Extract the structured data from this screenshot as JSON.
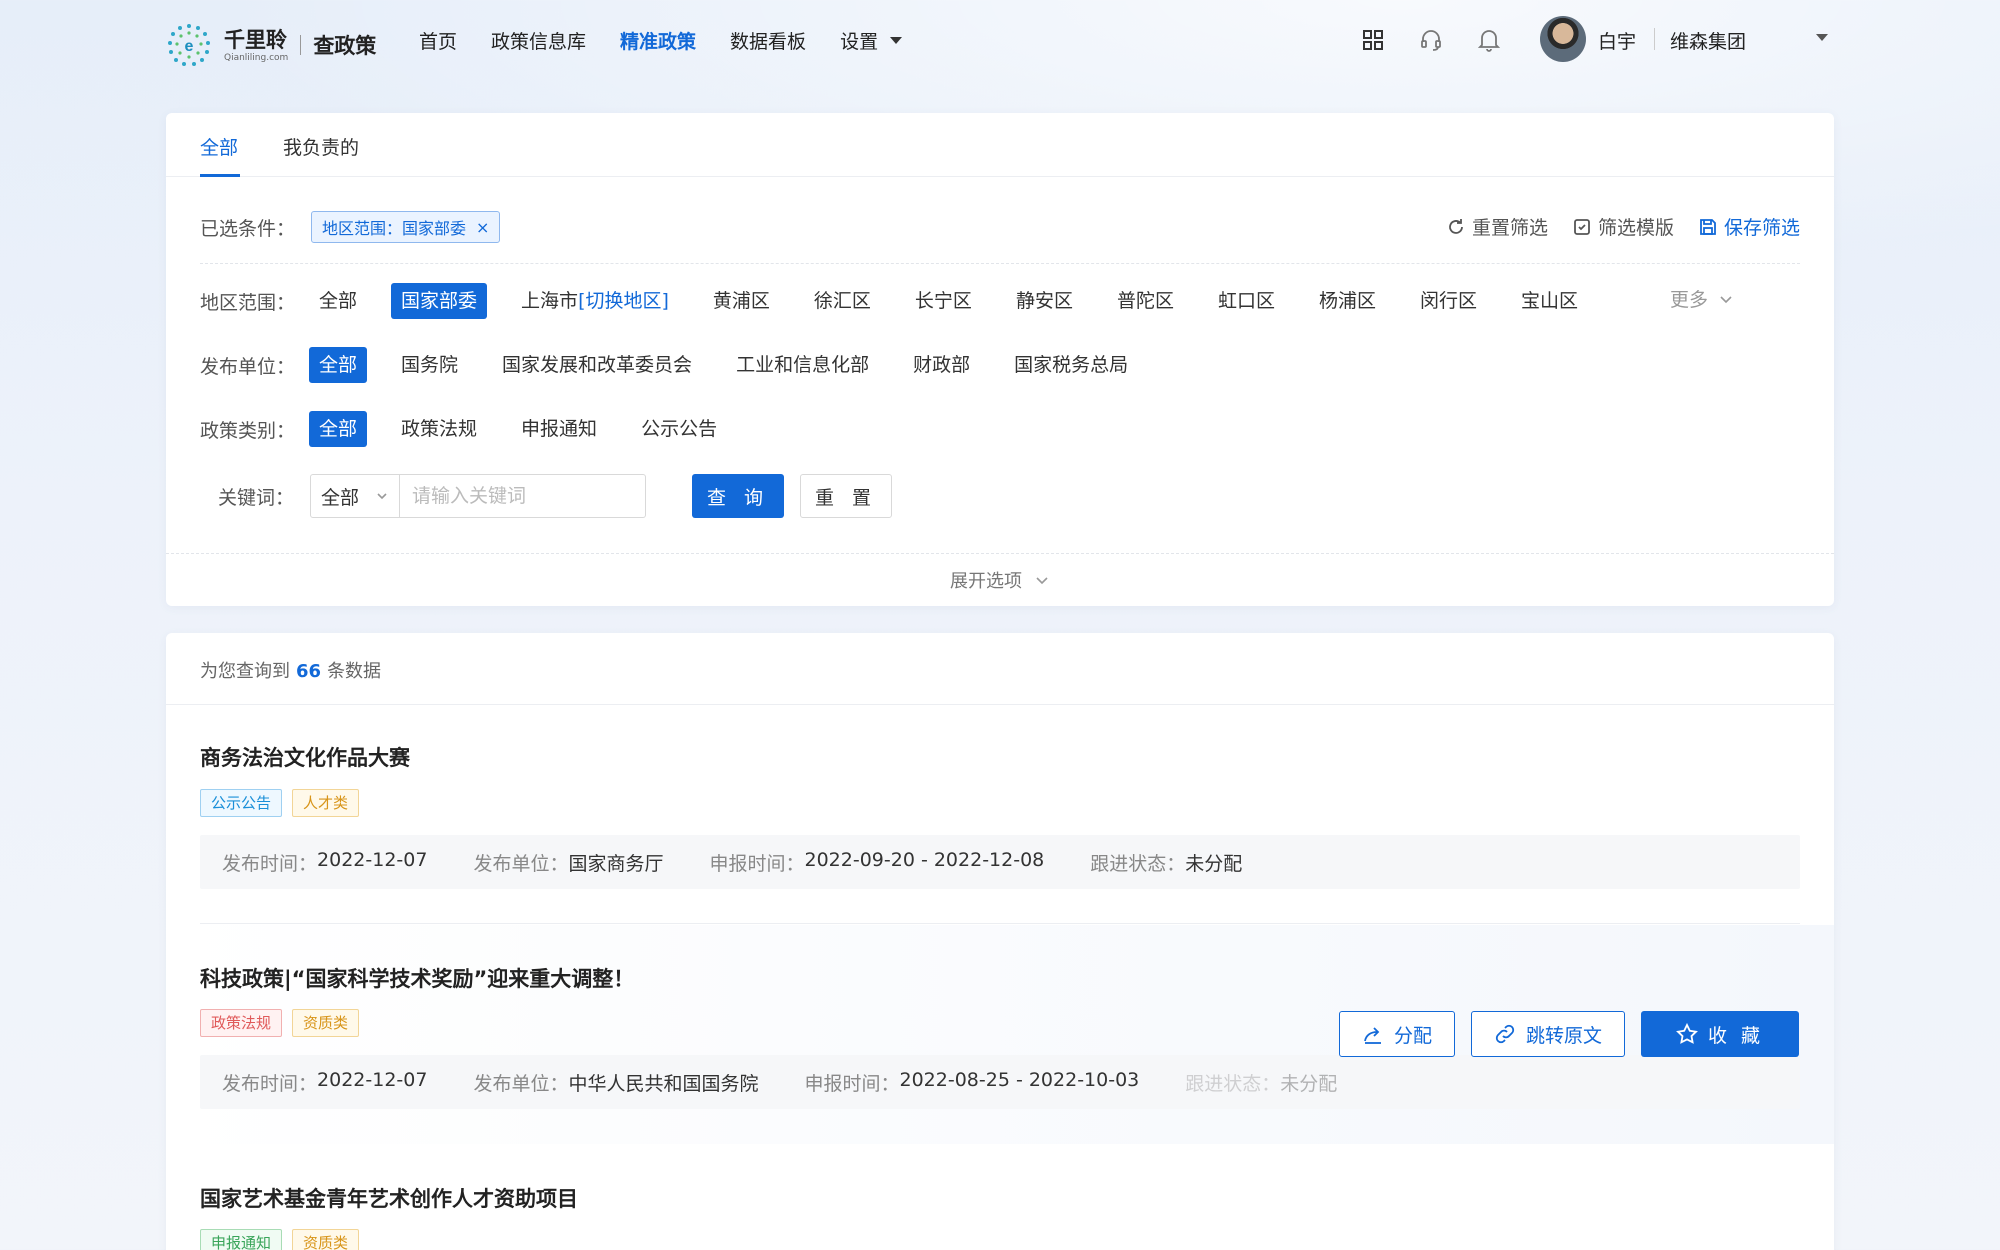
{
  "brand": {
    "name_cn": "千里聆",
    "name_en": "Qianliling.com",
    "product": "查政策"
  },
  "nav": {
    "items": [
      "首页",
      "政策信息库",
      "精准政策",
      "数据看板",
      "设置"
    ],
    "active_index": 2,
    "icons": [
      "apps-grid-icon",
      "headset-icon",
      "bell-icon"
    ]
  },
  "user": {
    "name": "白宇",
    "org": "维森集团"
  },
  "tabs": [
    "全部",
    "我负责的"
  ],
  "conditions": {
    "label": "已选条件：",
    "chip": "地区范围：国家部委",
    "actions": {
      "reset": "重置筛选",
      "template": "筛选模版",
      "save": "保存筛选"
    }
  },
  "filters": {
    "region": {
      "label": "地区范围：",
      "options": [
        "全部",
        "国家部委",
        "上海市",
        "黄浦区",
        "徐汇区",
        "长宁区",
        "静安区",
        "普陀区",
        "虹口区",
        "杨浦区",
        "闵行区",
        "宝山区"
      ],
      "switch_label": "[切换地区]",
      "selected": "国家部委",
      "more": "更多"
    },
    "publisher": {
      "label": "发布单位：",
      "options": [
        "全部",
        "国务院",
        "国家发展和改革委员会",
        "工业和信息化部",
        "财政部",
        "国家税务总局"
      ],
      "selected": "全部"
    },
    "category": {
      "label": "政策类别：",
      "options": [
        "全部",
        "政策法规",
        "申报通知",
        "公示公告"
      ],
      "selected": "全部"
    },
    "keyword": {
      "label": "关键词：",
      "scope": "全部",
      "placeholder": "请输入关键词",
      "value": "",
      "query_button": "查 询",
      "reset_button": "重 置"
    },
    "expand": "展开选项"
  },
  "results": {
    "prefix": "为您查询到",
    "count": "66",
    "suffix": "条数据",
    "meta_labels": {
      "publish_time": "发布时间：",
      "publisher": "发布单位：",
      "apply_time": "申报时间：",
      "status": "跟进状态："
    },
    "items": [
      {
        "title": "商务法治文化作品大赛",
        "tags": [
          {
            "text": "公示公告",
            "color": "#1a8fd8"
          },
          {
            "text": "人才类",
            "color": "#d8951a"
          }
        ],
        "publish_time": "2022-12-07",
        "publisher": "国家商务厅",
        "apply_time": "2022-09-20 - 2022-12-08",
        "status": "未分配"
      },
      {
        "title": "科技政策|“国家科学技术奖励”迎来重大调整！",
        "tags": [
          {
            "text": "政策法规",
            "color": "#e05a5a"
          },
          {
            "text": "资质类",
            "color": "#d8951a"
          }
        ],
        "publish_time": "2022-12-07",
        "publisher": "中华人民共和国国务院",
        "apply_time": "2022-08-25 - 2022-10-03",
        "status": "未分配"
      },
      {
        "title": "国家艺术基金青年艺术创作人才资助项目",
        "tags": [
          {
            "text": "申报通知",
            "color": "#3aa55a"
          },
          {
            "text": "资质类",
            "color": "#d8951a"
          }
        ]
      }
    ],
    "actions": {
      "assign": "分配",
      "jump": "跳转原文",
      "favorite": "收 藏"
    }
  },
  "colors": {
    "primary": "#1269d8",
    "background": "#edf2fa"
  }
}
